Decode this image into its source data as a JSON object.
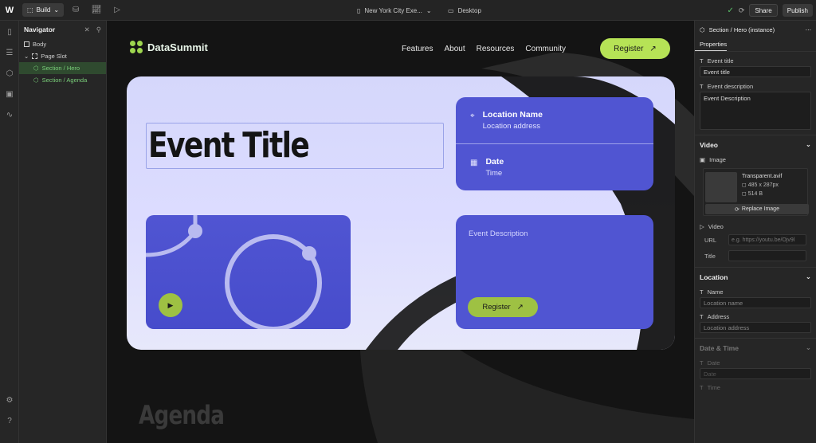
{
  "toolbar": {
    "logo": "W",
    "mode_label": "Build",
    "page_name": "New York City Exe...",
    "breakpoint": "Desktop",
    "share_label": "Share",
    "publish_label": "Publish"
  },
  "navigator": {
    "title": "Navigator",
    "items": [
      {
        "label": "Body"
      },
      {
        "label": "Page Slot"
      },
      {
        "label": "Section / Hero"
      },
      {
        "label": "Section / Agenda"
      }
    ]
  },
  "site": {
    "brand": "DataSummit",
    "nav_links": [
      "Features",
      "About",
      "Resources",
      "Community"
    ],
    "register_label": "Register",
    "register_icon": "arrow-up-right-icon"
  },
  "hero": {
    "event_title": "Event Title",
    "location_name": "Location Name",
    "location_address": "Location address",
    "date_label": "Date",
    "time_label": "Time",
    "event_description": "Event Description",
    "register_label": "Register"
  },
  "below": {
    "agenda_heading": "Agenda"
  },
  "panel": {
    "component_name": "Section / Hero (instance)",
    "tab": "Properties",
    "event_title_label": "Event title",
    "event_title_value": "Event title",
    "event_description_label": "Event description",
    "event_description_value": "Event Description",
    "video_section": "Video",
    "image_label": "Image",
    "image_file": "Transparent.avif",
    "image_dims": "485 x 287px",
    "image_size": "514 B",
    "replace_label": "Replace Image",
    "video_label": "Video",
    "url_label": "URL",
    "url_placeholder": "e.g. https://youtu.be/Ojv9l",
    "title_label": "Title",
    "location_section": "Location",
    "name_label": "Name",
    "name_placeholder": "Location name",
    "address_label": "Address",
    "address_placeholder": "Location address",
    "datetime_section": "Date & Time",
    "date_label": "Date",
    "date_placeholder": "Date",
    "time_label": "Time"
  },
  "colors": {
    "accent_green": "#b6e356",
    "card_blue": "#5055d2",
    "hero_bg": "#d5d7fb",
    "canvas_bg": "#141414"
  }
}
